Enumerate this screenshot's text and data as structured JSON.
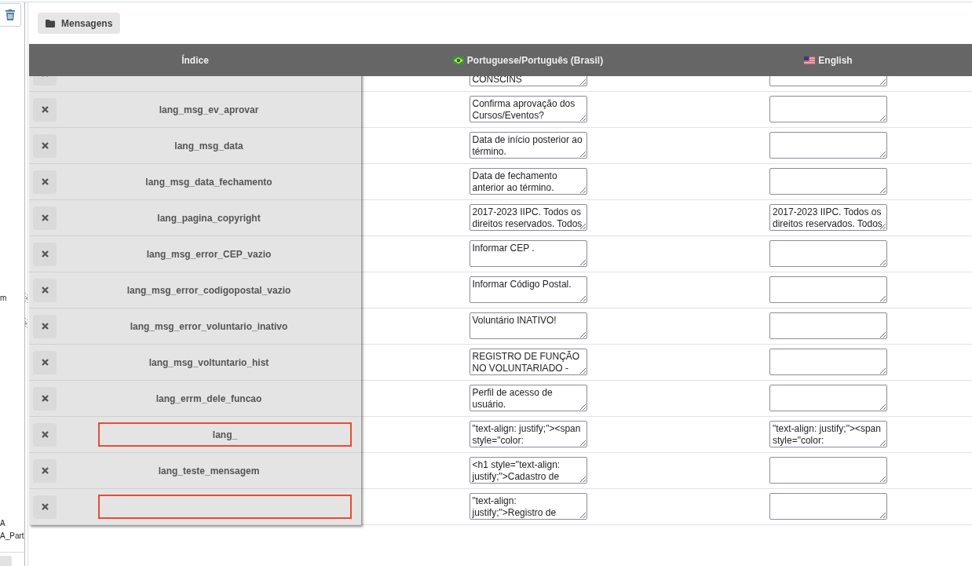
{
  "sidebar": {
    "items": [
      {
        "label": "m"
      },
      {
        "label": "A"
      },
      {
        "label": "A_Part"
      }
    ]
  },
  "toolbar": {
    "button": "Mensagens"
  },
  "table": {
    "columns": [
      {
        "label": "Índice",
        "kind": "plain"
      },
      {
        "label": "Portuguese/Português (Brasil)",
        "kind": "brazil_flag"
      },
      {
        "label": "English",
        "kind": "us_flag"
      }
    ],
    "rows": [
      {
        "index": {
          "kind": "label"
        },
        "pt": "CONSCINS"
      },
      {
        "index": {
          "kind": "label",
          "text": "lang_msg_ev_aprovar"
        },
        "pt": "Confirma aprovação dos Cursos/Eventos?"
      },
      {
        "index": {
          "kind": "label",
          "text": "lang_msg_data"
        },
        "pt": "Data de início posterior ao término."
      },
      {
        "index": {
          "kind": "label",
          "text": "lang_msg_data_fechamento"
        },
        "pt": "Data de fechamento anterior ao término."
      },
      {
        "index": {
          "kind": "label",
          "text": "lang_pagina_copyright"
        },
        "pt": "2017-2023 IIPC. Todos os direitos reservados. Todos",
        "en": "2017-2023 IIPC. Todos os direitos reservados. Todos"
      },
      {
        "index": {
          "kind": "label",
          "text": "lang_msg_error_CEP_vazio"
        },
        "pt": "Informar CEP ."
      },
      {
        "index": {
          "kind": "label",
          "text": "lang_msg_error_codigopostal_vazio"
        },
        "pt": "Informar Código Postal."
      },
      {
        "index": {
          "kind": "label",
          "text": "lang_msg_error_voluntario_inativo"
        },
        "pt": "Voluntário INATIVO!"
      },
      {
        "index": {
          "kind": "label",
          "text": "lang_msg_voltuntario_hist"
        },
        "pt": "REGISTRO DE FUNÇÃO NO VOLUNTARIADO -"
      },
      {
        "index": {
          "kind": "label",
          "text": "lang_errm_dele_funcao"
        },
        "pt": "Perfil de acesso de usuário."
      },
      {
        "index": {
          "kind": "input",
          "value": "lang_",
          "invalid": true
        },
        "pt": "\"text-align: justify;\"><span style=\"color:",
        "en": "\"text-align: justify;\"><span style=\"color:"
      },
      {
        "index": {
          "kind": "label",
          "text": "lang_teste_mensagem"
        },
        "pt": "<h1 style=\"text-align: justify;\">Cadastro de"
      },
      {
        "index": {
          "kind": "input",
          "invalid": true
        },
        "pt": "\"text-align: justify;\">Registro de"
      }
    ]
  }
}
